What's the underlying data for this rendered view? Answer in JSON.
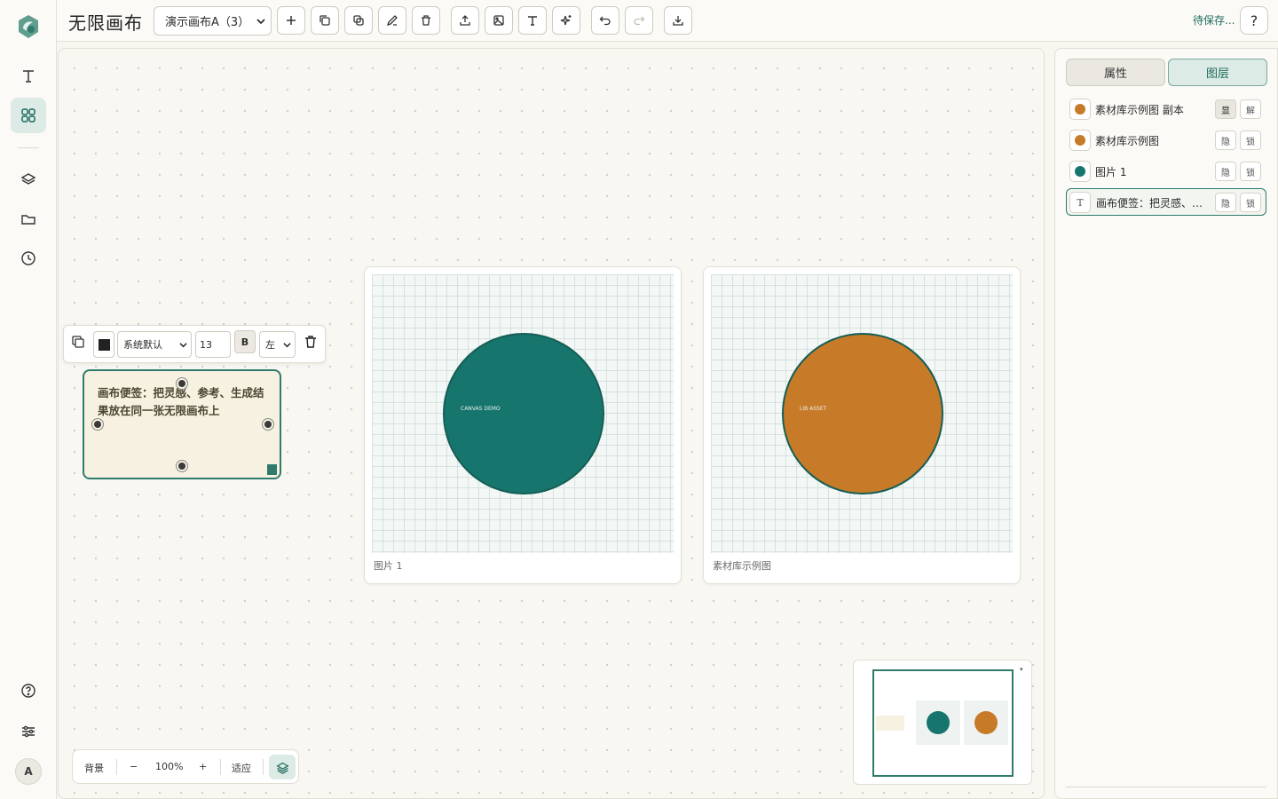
{
  "app": {
    "title": "无限画布",
    "save_status": "待保存...",
    "help_label": "?"
  },
  "toolbar": {
    "canvas_select": "演示画布A（3）",
    "buttons": [
      "add-icon",
      "duplicate-icon",
      "copy-icon",
      "rename-icon",
      "trash-icon",
      "upload-icon",
      "image-icon",
      "text-icon",
      "sparkle-icon",
      "undo-icon",
      "redo-icon",
      "download-icon"
    ]
  },
  "rail": {
    "top_items": [
      "text-tool-icon",
      "assets-grid-icon"
    ],
    "middle_items": [
      "layers-icon",
      "folder-icon",
      "history-icon"
    ],
    "bottom_items": [
      "help-circle-icon",
      "sliders-icon"
    ],
    "avatar_initial": "A"
  },
  "canvas": {
    "cards": [
      {
        "caption": "图片 1",
        "circle_text": "CANVAS DEMO",
        "fill": "#16756c"
      },
      {
        "caption": "素材库示例图",
        "circle_text": "LIB ASSET",
        "fill": "#c77a27"
      }
    ],
    "note": {
      "text": "画布便签：把灵感、参考、生成结果放在同一张无限画布上",
      "color": "#f6f1e0",
      "border": "#2f7b6c"
    },
    "note_toolbar": {
      "font": "系统默认",
      "size": "13",
      "bold": "B",
      "align": "左"
    }
  },
  "zoombar": {
    "background": "背景",
    "minus": "−",
    "zoom": "100%",
    "plus": "+",
    "fit": "适应"
  },
  "minimap": {
    "collapse": "▾"
  },
  "panel": {
    "tabs": [
      "属性",
      "图层"
    ],
    "active_tab": "图层",
    "layers": [
      {
        "name": "素材库示例图 副本",
        "type": "image",
        "color": "#c77a27",
        "vis": "显",
        "lock": "解",
        "vis_on": true
      },
      {
        "name": "素材库示例图",
        "type": "image",
        "color": "#c77a27",
        "vis": "隐",
        "lock": "锁",
        "vis_on": false
      },
      {
        "name": "图片 1",
        "type": "image",
        "color": "#16756c",
        "vis": "隐",
        "lock": "锁",
        "vis_on": false
      },
      {
        "name": "画布便签：把灵感、参考、生成结果放在同一张无限画布上",
        "type": "text",
        "glyph": "T",
        "vis": "隐",
        "lock": "锁",
        "vis_on": false,
        "selected": true
      }
    ]
  },
  "colors": {
    "accent": "#1f6b5e",
    "teal": "#16756c",
    "orange": "#c77a27",
    "note": "#f6f1e0"
  }
}
